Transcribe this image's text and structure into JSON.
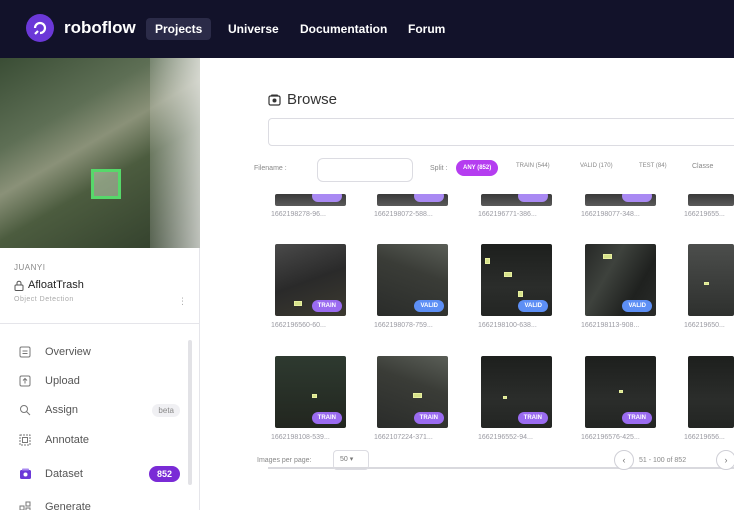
{
  "nav": {
    "brand": "roboflow",
    "items": [
      "Projects",
      "Universe",
      "Documentation",
      "Forum"
    ]
  },
  "sidebar": {
    "workspace": "JUANYI",
    "project_name": "AfloatTrash",
    "project_type": "Object Detection",
    "more": "⋮",
    "menu": [
      {
        "label": "Overview",
        "icon": "overview-icon"
      },
      {
        "label": "Upload",
        "icon": "upload-icon"
      },
      {
        "label": "Assign",
        "icon": "search-icon",
        "badge": "beta"
      },
      {
        "label": "Annotate",
        "icon": "annotate-icon"
      },
      {
        "label": "Dataset",
        "icon": "dataset-icon",
        "badge": "852"
      },
      {
        "label": "Generate",
        "icon": "generate-icon"
      }
    ]
  },
  "browse": {
    "title": "Browse",
    "search_value": "",
    "filename_label": "Filename :",
    "filename_value": "",
    "split_label": "Split :",
    "split_pills": [
      "ANY (852)",
      "TRAIN (544)",
      "VALID (170)",
      "TEST (84)",
      "Classe"
    ]
  },
  "grid": {
    "row0": [
      "1662198278-96...",
      "1662198072-588...",
      "1662196771-386...",
      "1662198077-348...",
      "166219655..."
    ],
    "row1": [
      {
        "file": "1662196560-60...",
        "split": "TRAIN"
      },
      {
        "file": "1662198078-759...",
        "split": "VALID"
      },
      {
        "file": "1662198100-638...",
        "split": "VALID"
      },
      {
        "file": "1662198113-908...",
        "split": "VALID"
      },
      {
        "file": "166219650..."
      }
    ],
    "row2": [
      {
        "file": "1662198108-539...",
        "split": "TRAIN"
      },
      {
        "file": "1662107224-371...",
        "split": "TRAIN"
      },
      {
        "file": "1662196552-94...",
        "split": "TRAIN"
      },
      {
        "file": "1662196576-425...",
        "split": "TRAIN"
      },
      {
        "file": "166219656..."
      }
    ]
  },
  "pagination": {
    "images_per_page_label": "Images per page:",
    "images_per_page_value": "50 ▾",
    "range_text": "51 - 100 of 852",
    "prev": "‹",
    "next": "›"
  }
}
